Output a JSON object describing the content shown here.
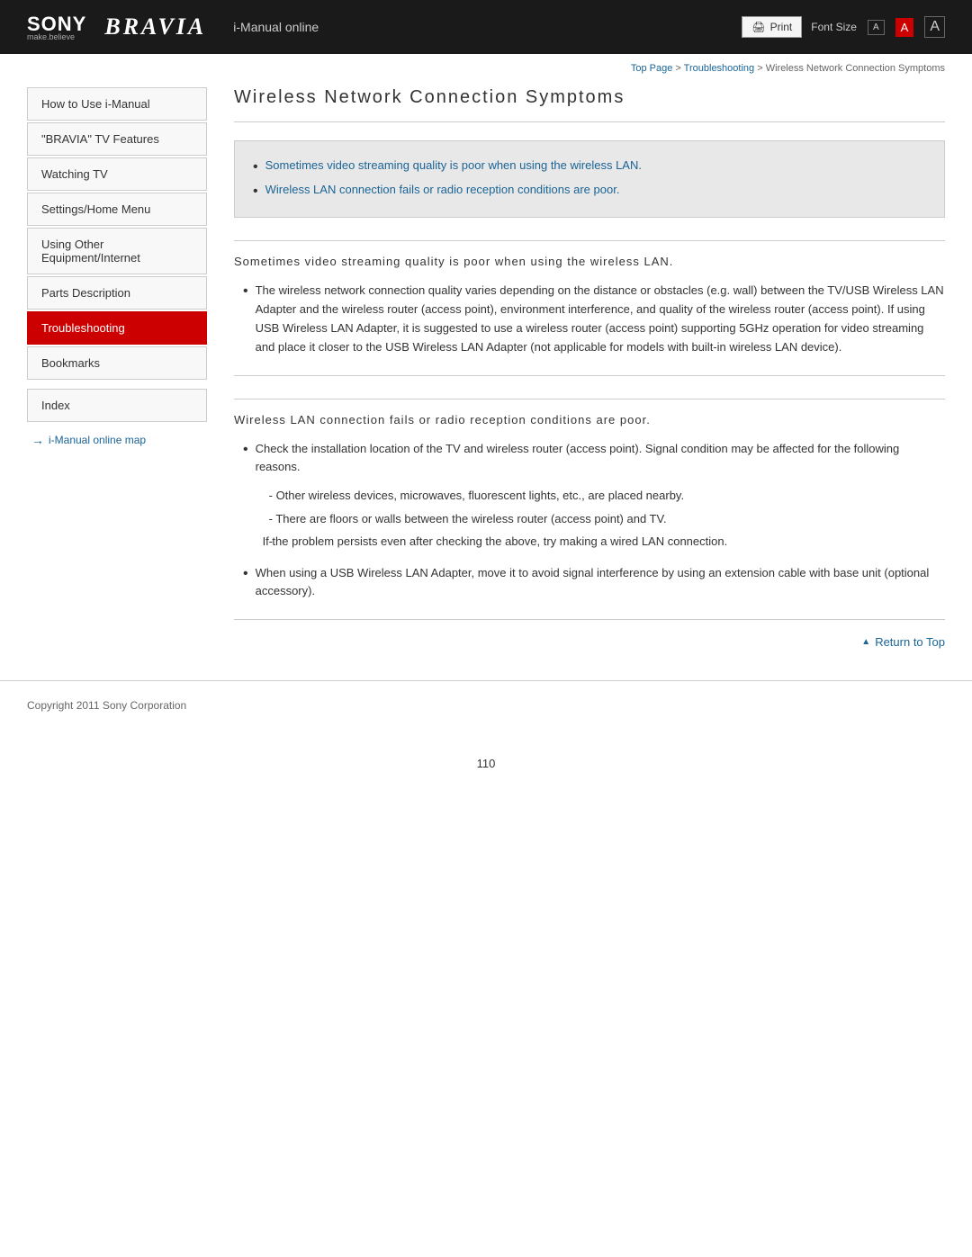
{
  "header": {
    "sony_logo": "SONY",
    "sony_tagline": "make.believe",
    "bravia_text": "BRAVIA",
    "imanual_label": "i-Manual online",
    "print_btn": "Print",
    "font_size_label": "Font Size",
    "font_small": "A",
    "font_medium": "A",
    "font_large": "A"
  },
  "breadcrumb": {
    "top_page": "Top Page",
    "separator1": " > ",
    "troubleshooting": "Troubleshooting",
    "separator2": " > ",
    "current": "Wireless Network Connection Symptoms"
  },
  "sidebar": {
    "items": [
      {
        "label": "How to Use i-Manual",
        "active": false
      },
      {
        "label": "\"BRAVIA\" TV Features",
        "active": false
      },
      {
        "label": "Watching TV",
        "active": false
      },
      {
        "label": "Settings/Home Menu",
        "active": false
      },
      {
        "label": "Using Other Equipment/Internet",
        "active": false
      },
      {
        "label": "Parts Description",
        "active": false
      },
      {
        "label": "Troubleshooting",
        "active": true
      },
      {
        "label": "Bookmarks",
        "active": false
      }
    ],
    "index_label": "Index",
    "map_link": "i-Manual online map"
  },
  "content": {
    "page_title": "Wireless Network Connection Symptoms",
    "symptom_links": [
      "Sometimes video streaming quality is poor when using the wireless LAN.",
      "Wireless LAN connection fails or radio reception conditions are poor."
    ],
    "section1": {
      "heading": "Sometimes video streaming quality is poor when using the wireless LAN.",
      "bullets": [
        "The wireless network connection quality varies depending on the distance or obstacles (e.g. wall) between the TV/USB Wireless LAN Adapter and the wireless router (access point), environment interference, and quality of the wireless router (access point). If using USB Wireless LAN Adapter, it is suggested to use a wireless router (access point) supporting 5GHz operation for video streaming and place it closer to the USB Wireless LAN Adapter (not applicable for models with built-in wireless LAN device)."
      ]
    },
    "section2": {
      "heading": "Wireless LAN connection fails or radio reception conditions are poor.",
      "bullets": [
        {
          "main": "Check the installation location of the TV and wireless router (access point). Signal condition may be affected for the following reasons.",
          "sub": [
            "Other wireless devices, microwaves, fluorescent lights, etc., are placed nearby.",
            "There are floors or walls between the wireless router (access point) and TV.",
            "If the problem persists even after checking the above, try making a wired LAN connection."
          ]
        },
        {
          "main": "When using a USB Wireless LAN Adapter, move it to avoid signal interference by using an extension cable with base unit (optional accessory).",
          "sub": []
        }
      ]
    },
    "return_top": "Return to Top"
  },
  "footer": {
    "copyright": "Copyright 2011 Sony Corporation"
  },
  "page_number": "110"
}
